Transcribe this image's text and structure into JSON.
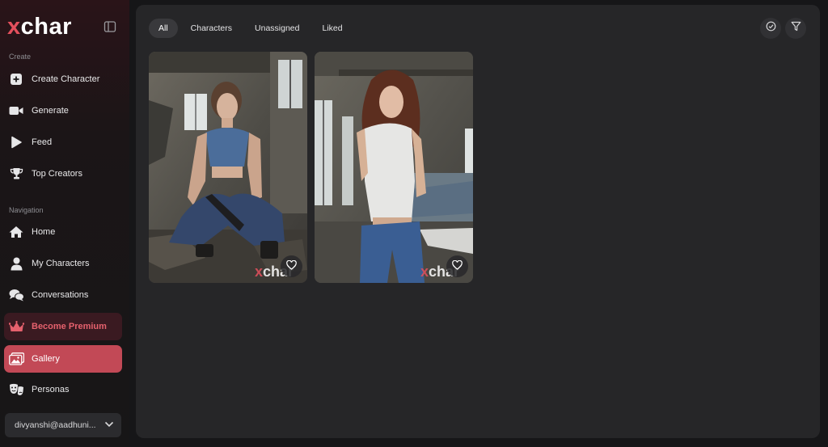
{
  "brand": {
    "logo_x": "x",
    "logo_rest": "char"
  },
  "sidebar": {
    "create_label": "Create",
    "create_items": [
      {
        "label": "Create Character",
        "icon": "plus-icon"
      },
      {
        "label": "Generate",
        "icon": "video-camera-icon"
      },
      {
        "label": "Feed",
        "icon": "play-icon"
      },
      {
        "label": "Top Creators",
        "icon": "trophy-icon"
      }
    ],
    "navigation_label": "Navigation",
    "nav_items": [
      {
        "label": "Home",
        "icon": "home-icon"
      },
      {
        "label": "My Characters",
        "icon": "user-icon"
      },
      {
        "label": "Conversations",
        "icon": "chat-bubbles-icon"
      },
      {
        "label": "Become Premium",
        "icon": "crown-icon"
      },
      {
        "label": "Gallery",
        "icon": "images-icon",
        "active": true
      },
      {
        "label": "Personas",
        "icon": "masks-icon"
      }
    ],
    "account": "divyanshi@aadhuni..."
  },
  "main": {
    "tabs": [
      {
        "label": "All",
        "active": true
      },
      {
        "label": "Characters"
      },
      {
        "label": "Unassigned"
      },
      {
        "label": "Liked"
      }
    ],
    "gallery": [
      {
        "watermark_x": "x",
        "watermark_rest": "char"
      },
      {
        "watermark_x": "x",
        "watermark_rest": "char"
      }
    ]
  },
  "colors": {
    "accent": "#c24956",
    "premium_text": "#e5616d",
    "background": "#161618",
    "panel": "#262628"
  }
}
